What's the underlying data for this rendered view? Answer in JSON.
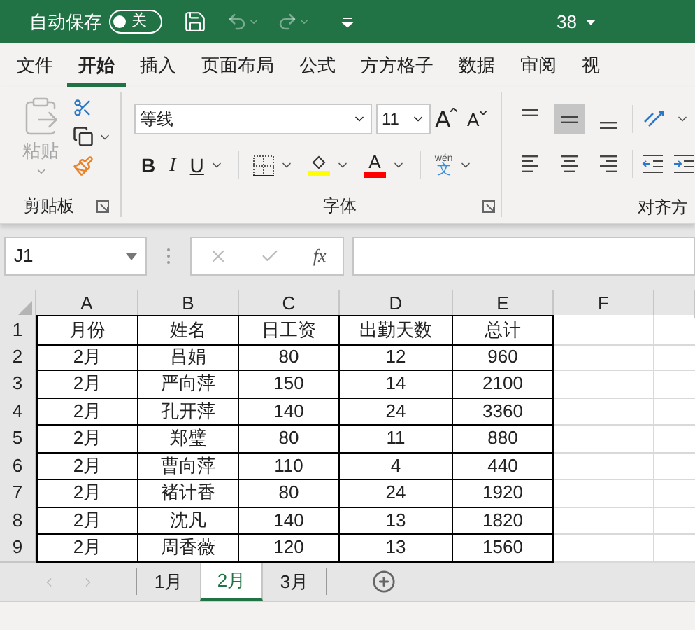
{
  "title_bar": {
    "autosave_label": "自动保存",
    "autosave_on": false,
    "autosave_state": "关",
    "file_name": "38"
  },
  "ribbon_tabs": [
    {
      "label": "文件",
      "selected": false
    },
    {
      "label": "开始",
      "selected": true
    },
    {
      "label": "插入",
      "selected": false
    },
    {
      "label": "页面布局",
      "selected": false
    },
    {
      "label": "公式",
      "selected": false
    },
    {
      "label": "方方格子",
      "selected": false
    },
    {
      "label": "数据",
      "selected": false
    },
    {
      "label": "审阅",
      "selected": false
    },
    {
      "label": "视",
      "selected": false
    }
  ],
  "clipboard": {
    "paste_label": "粘贴",
    "group_label": "剪贴板"
  },
  "font": {
    "name": "等线",
    "size": "11",
    "grow": "A",
    "shrink": "A",
    "bold": "B",
    "italic": "I",
    "underline": "U",
    "font_color": "A",
    "phonetic_top": "wén",
    "phonetic_bottom": "文",
    "group_label": "字体"
  },
  "alignment": {
    "group_label": "对齐方",
    "vertical": [
      {
        "kind": "top",
        "selected": false
      },
      {
        "kind": "middle",
        "selected": true
      },
      {
        "kind": "bottom",
        "selected": false
      }
    ],
    "horizontal": [
      {
        "kind": "left",
        "selected": false
      },
      {
        "kind": "center",
        "selected": false
      },
      {
        "kind": "right",
        "selected": false
      }
    ]
  },
  "formula_bar": {
    "name_box": "J1",
    "fx": "fx"
  },
  "columns": [
    "A",
    "B",
    "C",
    "D",
    "E",
    "F"
  ],
  "rows": [
    {
      "number": "1",
      "cells": [
        "月份",
        "姓名",
        "日工资",
        "出勤天数",
        "总计"
      ]
    },
    {
      "number": "2",
      "cells": [
        "2月",
        "吕娟",
        "80",
        "12",
        "960"
      ]
    },
    {
      "number": "3",
      "cells": [
        "2月",
        "严向萍",
        "150",
        "14",
        "2100"
      ]
    },
    {
      "number": "4",
      "cells": [
        "2月",
        "孔开萍",
        "140",
        "24",
        "3360"
      ]
    },
    {
      "number": "5",
      "cells": [
        "2月",
        "郑璧",
        "80",
        "11",
        "880"
      ]
    },
    {
      "number": "6",
      "cells": [
        "2月",
        "曹向萍",
        "110",
        "4",
        "440"
      ]
    },
    {
      "number": "7",
      "cells": [
        "2月",
        "褚计香",
        "80",
        "24",
        "1920"
      ]
    },
    {
      "number": "8",
      "cells": [
        "2月",
        "沈凡",
        "140",
        "13",
        "1820"
      ]
    },
    {
      "number": "9",
      "cells": [
        "2月",
        "周香薇",
        "120",
        "13",
        "1560"
      ]
    }
  ],
  "sheet_tabs": [
    {
      "label": "1月",
      "selected": false
    },
    {
      "label": "2月",
      "selected": true
    },
    {
      "label": "3月",
      "selected": false
    }
  ]
}
